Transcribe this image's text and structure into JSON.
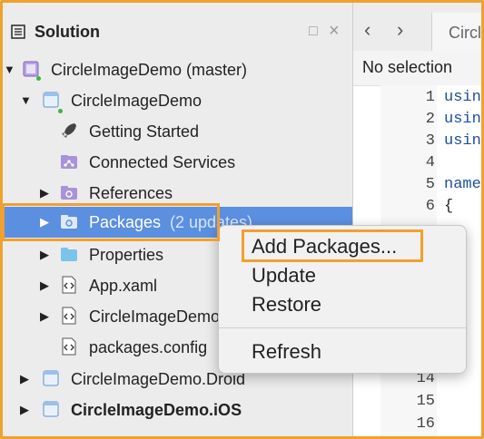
{
  "solution_panel": {
    "title": "Solution",
    "minimize_glyph": "□",
    "close_glyph": "×",
    "tree": [
      {
        "label": "CircleImageDemo (master)",
        "icon": "solution-icon"
      },
      {
        "label": "CircleImageDemo",
        "icon": "project-icon"
      },
      {
        "label": "Getting Started",
        "icon": "rocket-icon"
      },
      {
        "label": "Connected Services",
        "icon": "connected-services-icon"
      },
      {
        "label": "References",
        "icon": "references-folder-icon"
      },
      {
        "label": "Packages",
        "badge": "(2 updates)",
        "icon": "packages-folder-icon",
        "selected": true
      },
      {
        "label": "Properties",
        "icon": "folder-icon"
      },
      {
        "label": "App.xaml",
        "icon": "code-file-icon"
      },
      {
        "label": "CircleImageDemo",
        "icon": "code-file-icon"
      },
      {
        "label": "packages.config",
        "icon": "code-file-icon"
      },
      {
        "label": "CircleImageDemo.Droid",
        "icon": "project-icon"
      },
      {
        "label": "CircleImageDemo.iOS",
        "icon": "project-icon",
        "bold": true
      }
    ]
  },
  "editor": {
    "back_glyph": "‹",
    "forward_glyph": "›",
    "tab_label": "Circl",
    "no_selection": "No selection",
    "lines": [
      {
        "n": "1",
        "code": "usin"
      },
      {
        "n": "2",
        "code": "usin"
      },
      {
        "n": "3",
        "code": "usin"
      },
      {
        "n": "4",
        "code": ""
      },
      {
        "n": "5",
        "code": "name"
      },
      {
        "n": "6",
        "code": "{"
      },
      {
        "n": "14",
        "code": ""
      },
      {
        "n": "15",
        "code": ""
      },
      {
        "n": "16",
        "code": ""
      }
    ]
  },
  "context_menu": {
    "items": [
      "Add Packages...",
      "Update",
      "Restore",
      "Refresh"
    ]
  },
  "colors": {
    "highlight_border": "#f0a030",
    "selection": "#5b8fe0"
  }
}
